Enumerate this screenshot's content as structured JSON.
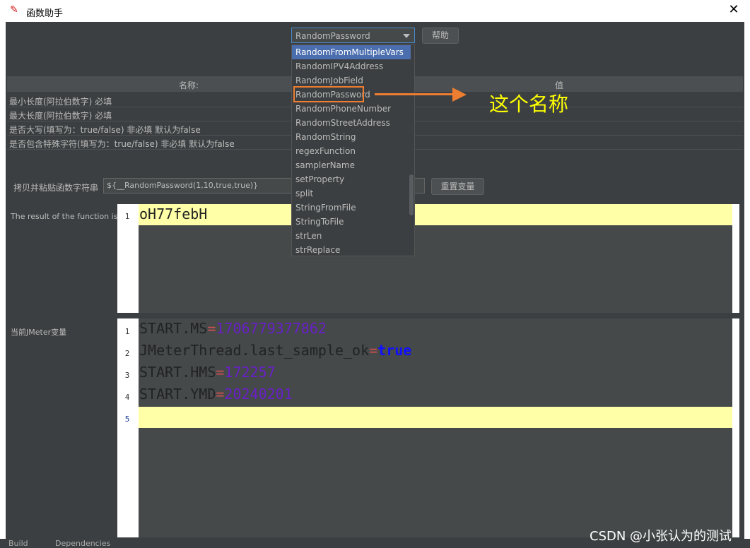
{
  "window": {
    "title": "函数助手"
  },
  "function_select": {
    "selected": "RandomPassword",
    "help_label": "帮助",
    "options": [
      "RandomFromMultipleVars",
      "RandomIPV4Address",
      "RandomJobField",
      "RandomPassword",
      "RandomPhoneNumber",
      "RandomStreetAddress",
      "RandomString",
      "regexFunction",
      "samplerName",
      "setProperty",
      "split",
      "StringFromFile",
      "StringToFile",
      "strLen",
      "strReplace"
    ],
    "highlighted_option": "RandomFromMultipleVars"
  },
  "params_table": {
    "col_name": "名称:",
    "col_value": "值",
    "rows": [
      "最小长度(阿拉伯数字) 必填",
      "最大长度(阿拉伯数字) 必填",
      "是否大写(填写为：true/false) 非必填 默认为false",
      "是否包含特殊字符(填写为：true/false) 非必填 默认为false"
    ]
  },
  "copy": {
    "label": "拷贝并粘贴函数字符串",
    "value": "${__RandomPassword(1,10,true,true)}",
    "reset_label": "重置变量"
  },
  "result": {
    "label": "The result of the function is",
    "line_no": "1",
    "value": "oH77febH"
  },
  "vars": {
    "label": "当前JMeter变量",
    "lines": [
      {
        "no": "1",
        "key": "START.MS",
        "eq": "=",
        "val": "1706779377862"
      },
      {
        "no": "2",
        "key": "JMeterThread.last_sample_ok",
        "eq": "=",
        "val": "true"
      },
      {
        "no": "3",
        "key": "START.HMS",
        "eq": "=",
        "val": "172257"
      },
      {
        "no": "4",
        "key": "START.YMD",
        "eq": "=",
        "val": "20240201"
      },
      {
        "no": "5",
        "key": "",
        "eq": "",
        "val": ""
      }
    ]
  },
  "annotation": {
    "text": "这个名称",
    "color": "#ffff00",
    "arrow_color": "#ed7d31"
  },
  "watermark": "CSDN @小张认为的测试",
  "bottom": {
    "build": "Build",
    "deps": "Dependencies"
  }
}
